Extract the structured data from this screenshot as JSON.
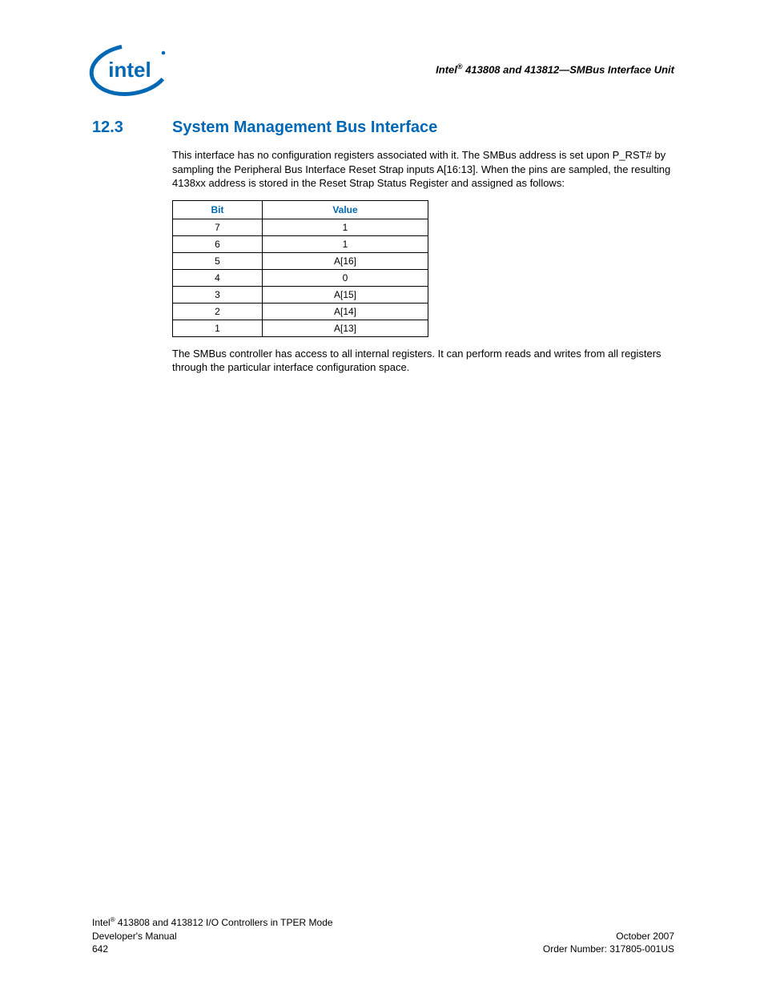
{
  "header": {
    "brand_prefix": "Intel",
    "reg": "®",
    "text": " 413808 and 413812—SMBus Interface Unit"
  },
  "section": {
    "number": "12.3",
    "title": "System Management Bus Interface"
  },
  "paragraphs": {
    "p1": "This interface has no configuration registers associated with it. The SMBus address is set upon P_RST# by sampling the Peripheral Bus Interface Reset Strap inputs A[16:13]. When the pins are sampled, the resulting 4138xx address is stored in the Reset Strap Status Register and assigned as follows:",
    "p2": "The SMBus controller has access to all internal registers. It can perform reads and writes from all registers through the particular interface configuration space."
  },
  "table": {
    "headers": {
      "bit": "Bit",
      "value": "Value"
    },
    "rows": [
      {
        "bit": "7",
        "value": "1"
      },
      {
        "bit": "6",
        "value": "1"
      },
      {
        "bit": "5",
        "value": "A[16]"
      },
      {
        "bit": "4",
        "value": "0"
      },
      {
        "bit": "3",
        "value": "A[15]"
      },
      {
        "bit": "2",
        "value": "A[14]"
      },
      {
        "bit": "1",
        "value": "A[13]"
      }
    ]
  },
  "footer": {
    "left_line1_prefix": "Intel",
    "left_line1_reg": "®",
    "left_line1_rest": " 413808 and 413812 I/O Controllers in TPER Mode",
    "left_line2": "Developer's Manual",
    "left_line3": "642",
    "right_line1": "October 2007",
    "right_line2": "Order Number: 317805-001US"
  }
}
